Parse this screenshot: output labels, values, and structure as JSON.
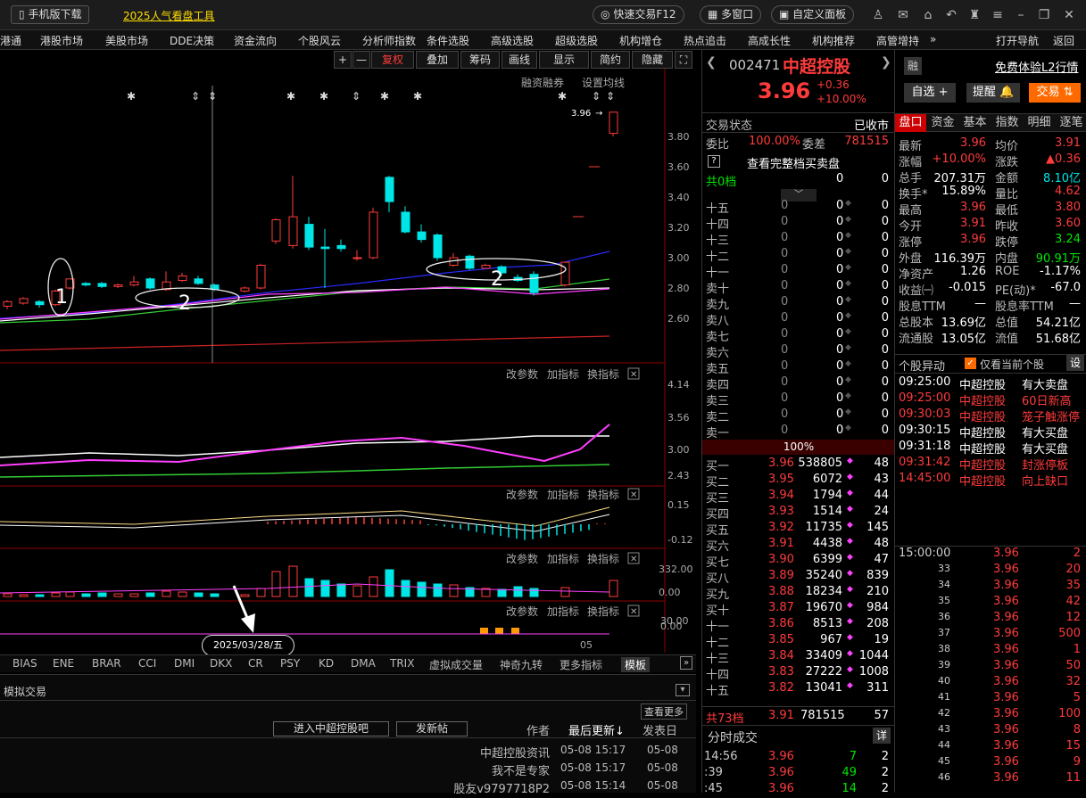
{
  "topbar": {
    "mobile": "手机版下载",
    "promo": "2025人气看盘工具",
    "quick_trade": "快速交易F12",
    "multi_window": "多窗口",
    "custom_panel": "自定义面板"
  },
  "menu": [
    "港通",
    "港股市场",
    "美股市场",
    "DDE决策",
    "资金流向",
    "个股风云",
    "分析师指数",
    "条件选股",
    "高级选股",
    "超级选股",
    "机构增仓",
    "热点追击",
    "高成长性",
    "机构推荐",
    "高管增持"
  ],
  "menu_more": "»",
  "menu_right": {
    "nav": "打开导航",
    "back": "返回"
  },
  "chart_toolbar": {
    "plus": "+",
    "minus": "—",
    "fuquan": "复权",
    "overlay": "叠加",
    "chips": "筹码",
    "draw": "画线",
    "show": "显示",
    "simple": "简约",
    "hide": "隐藏"
  },
  "chart_links": {
    "margin": "融资融券",
    "ma_setting": "设置均线"
  },
  "sub_links": {
    "params": "改参数",
    "add": "加指标",
    "change": "换指标"
  },
  "price_axis": [
    "3.80",
    "3.60",
    "3.40",
    "3.20",
    "3.00",
    "2.80",
    "2.60"
  ],
  "price_marker": "3.96",
  "sub1_axis": [
    "4.14",
    "3.56",
    "3.00",
    "2.43"
  ],
  "sub2_axis": [
    "0.15",
    "-0.12"
  ],
  "sub3_axis": [
    "332.00",
    "0.00"
  ],
  "sub4_axis": [
    "30.00",
    "0.00"
  ],
  "date_label": "2025/03/28/五",
  "month_label": "05",
  "annot": {
    "a1": "1",
    "a2": "2",
    "a3": "2"
  },
  "indicators": [
    "BIAS",
    "ENE",
    "BRAR",
    "CCI",
    "DMI",
    "DKX",
    "CR",
    "PSY",
    "KD",
    "DMA",
    "TRIX",
    "虚拟成交量",
    "神奇九转",
    "更多指标",
    "模板"
  ],
  "bottom": {
    "sim": "模拟交易",
    "view_more": "查看更多",
    "enter": "进入中超控股吧",
    "post": "发新帖",
    "author": "作者",
    "latest": "最后更新",
    "posted": "发表日",
    "posts": [
      {
        "title": "中超控股资讯",
        "update": "05-08 15:17",
        "date": "05-08"
      },
      {
        "title": "我不是专家",
        "update": "05-08 15:17",
        "date": "05-08"
      },
      {
        "title": "股友v9797718P2",
        "update": "05-08 15:14",
        "date": "05-08"
      }
    ]
  },
  "stock": {
    "code": "002471",
    "name": "中超控股",
    "price": "3.96",
    "change": "+0.36",
    "pct": "+10.00%",
    "rong": "融",
    "l2": "免费体验L2行情",
    "zixuan": "自选",
    "tixing": "提醒",
    "jiaoyi": "交易"
  },
  "status": {
    "label": "交易状态",
    "value": "已收市",
    "wb_label": "委比",
    "wb": "100.00%",
    "wc_label": "委差",
    "wc": "781515",
    "full": "查看完整档买卖盘",
    "gong0": "共0档",
    "zero": "0",
    "pct100": "100%"
  },
  "sells": [
    "十五",
    "十四",
    "十三",
    "十二",
    "十一",
    "卖十",
    "卖九",
    "卖八",
    "卖七",
    "卖六",
    "卖五",
    "卖四",
    "卖三",
    "卖二",
    "卖一"
  ],
  "buys": [
    {
      "n": "买一",
      "p": "3.96",
      "v": "538805",
      "c": "48"
    },
    {
      "n": "买二",
      "p": "3.95",
      "v": "6072",
      "c": "43"
    },
    {
      "n": "买三",
      "p": "3.94",
      "v": "1794",
      "c": "44"
    },
    {
      "n": "买四",
      "p": "3.93",
      "v": "1514",
      "c": "24"
    },
    {
      "n": "买五",
      "p": "3.92",
      "v": "11735",
      "c": "145"
    },
    {
      "n": "买六",
      "p": "3.91",
      "v": "4438",
      "c": "48"
    },
    {
      "n": "买七",
      "p": "3.90",
      "v": "6399",
      "c": "47"
    },
    {
      "n": "买八",
      "p": "3.89",
      "v": "35240",
      "c": "839"
    },
    {
      "n": "买九",
      "p": "3.88",
      "v": "18234",
      "c": "210"
    },
    {
      "n": "买十",
      "p": "3.87",
      "v": "19670",
      "c": "984"
    },
    {
      "n": "十一",
      "p": "3.86",
      "v": "8513",
      "c": "208"
    },
    {
      "n": "十二",
      "p": "3.85",
      "v": "967",
      "c": "19"
    },
    {
      "n": "十三",
      "p": "3.84",
      "v": "33409",
      "c": "1044"
    },
    {
      "n": "十四",
      "p": "3.83",
      "v": "27222",
      "c": "1008"
    },
    {
      "n": "十五",
      "p": "3.82",
      "v": "13041",
      "c": "311"
    }
  ],
  "buy_total": {
    "label": "共73档",
    "p": "3.91",
    "v": "781515",
    "c": "57"
  },
  "trades_title": "分时成交",
  "trades_btn": "详",
  "trades": [
    {
      "t": "14:56",
      "p": "3.96",
      "v": "7",
      "c": "2"
    },
    {
      "t": ":39",
      "p": "3.96",
      "v": "49",
      "c": "2"
    },
    {
      "t": ":45",
      "p": "3.96",
      "v": "14",
      "c": "2"
    }
  ],
  "tabs": [
    "盘口",
    "资金",
    "基本",
    "指数",
    "明细",
    "逐笔"
  ],
  "stats": [
    [
      "最新",
      "3.96",
      "均价",
      "3.91"
    ],
    [
      "涨幅",
      "+10.00%",
      "涨跌",
      "▲0.36"
    ],
    [
      "总手",
      "207.31万",
      "金额",
      "8.10亿"
    ],
    [
      "换手*",
      "15.89%",
      "量比",
      "4.62"
    ],
    [
      "最高",
      "3.96",
      "最低",
      "3.80"
    ],
    [
      "今开",
      "3.91",
      "昨收",
      "3.60"
    ],
    [
      "涨停",
      "3.96",
      "跌停",
      "3.24"
    ],
    [
      "外盘",
      "116.39万",
      "内盘",
      "90.91万"
    ],
    [
      "净资产",
      "1.26",
      "ROE",
      "-1.17%"
    ],
    [
      "收益㈠",
      "-0.015",
      "PE(动)*",
      "-67.0"
    ],
    [
      "股息TTM",
      "—",
      "股息率TTM",
      "—"
    ],
    [
      "总股本",
      "13.69亿",
      "总值",
      "54.21亿"
    ],
    [
      "流通股",
      "13.05亿",
      "流值",
      "51.68亿"
    ]
  ],
  "alerts_title": "个股异动",
  "alerts_only": "仅看当前个股",
  "alerts_set": "设",
  "alerts": [
    {
      "t": "09:25:00",
      "n": "中超控股",
      "e": "有大卖盘",
      "red": false
    },
    {
      "t": "09:25:00",
      "n": "中超控股",
      "e": "60日新高",
      "red": true
    },
    {
      "t": "09:30:03",
      "n": "中超控股",
      "e": "笼子触涨停",
      "red": true
    },
    {
      "t": "09:30:15",
      "n": "中超控股",
      "e": "有大买盘",
      "red": false
    },
    {
      "t": "09:31:18",
      "n": "中超控股",
      "e": "有大买盘",
      "red": false
    },
    {
      "t": "09:31:42",
      "n": "中超控股",
      "e": "封涨停板",
      "red": true
    },
    {
      "t": "14:45:00",
      "n": "中超控股",
      "e": "向上缺口",
      "red": true
    }
  ],
  "ticks": [
    {
      "t": "15:00:00",
      "p": "3.96",
      "v": "2"
    },
    {
      "t": "33",
      "p": "3.96",
      "v": "20"
    },
    {
      "t": "34",
      "p": "3.96",
      "v": "35"
    },
    {
      "t": "35",
      "p": "3.96",
      "v": "42"
    },
    {
      "t": "36",
      "p": "3.96",
      "v": "12"
    },
    {
      "t": "37",
      "p": "3.96",
      "v": "500"
    },
    {
      "t": "38",
      "p": "3.96",
      "v": "1"
    },
    {
      "t": "39",
      "p": "3.96",
      "v": "50"
    },
    {
      "t": "40",
      "p": "3.96",
      "v": "32"
    },
    {
      "t": "41",
      "p": "3.96",
      "v": "5"
    },
    {
      "t": "42",
      "p": "3.96",
      "v": "100"
    },
    {
      "t": "43",
      "p": "3.96",
      "v": "8"
    },
    {
      "t": "44",
      "p": "3.96",
      "v": "15"
    },
    {
      "t": "45",
      "p": "3.96",
      "v": "9"
    },
    {
      "t": "46",
      "p": "3.96",
      "v": "11"
    }
  ],
  "colors": {
    "up": "#ff3b3b",
    "down": "#00e6e6",
    "accent": "#ff6a00"
  }
}
